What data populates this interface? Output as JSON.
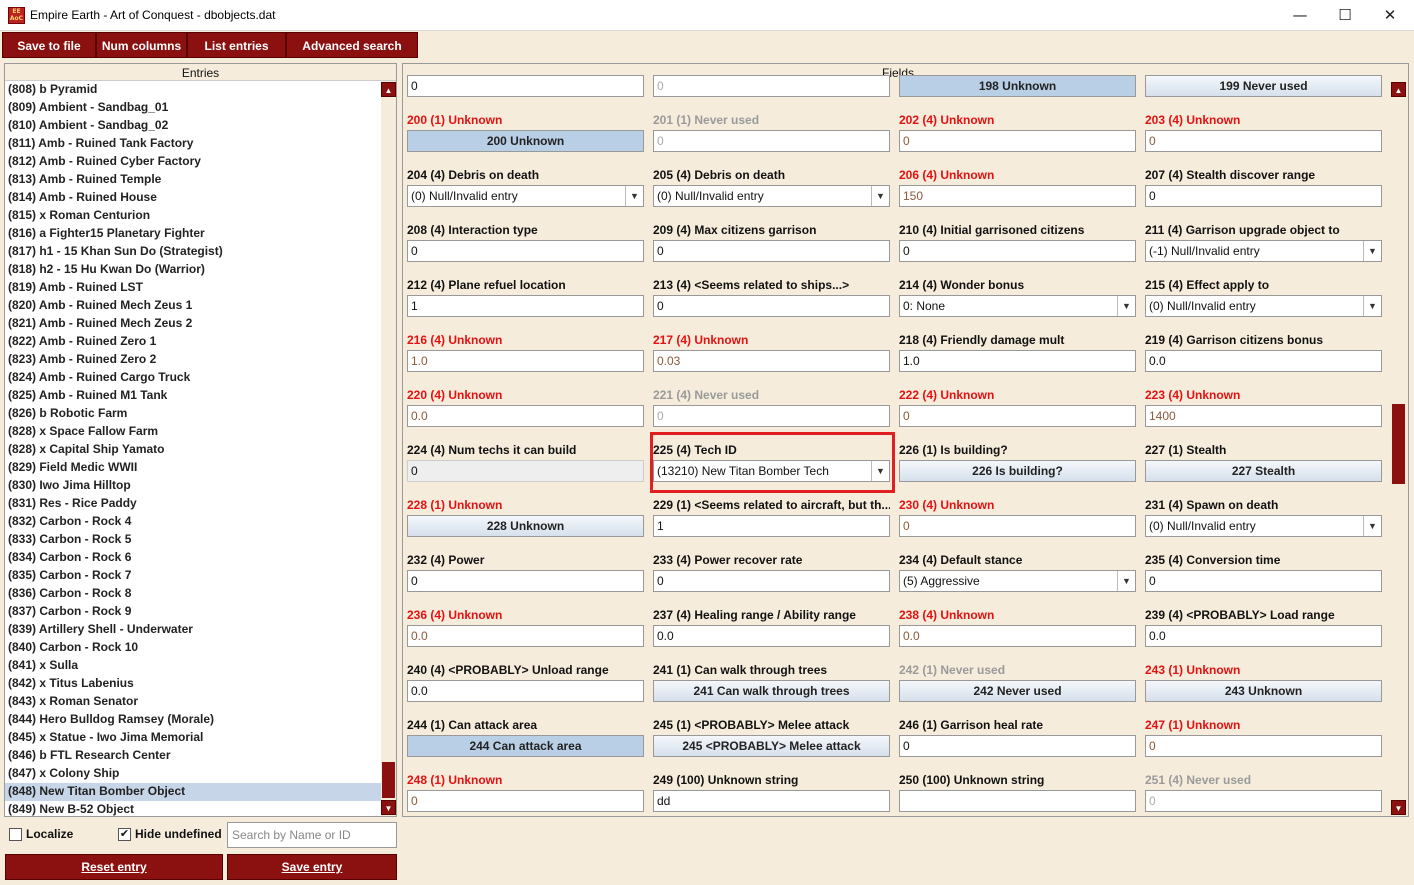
{
  "window": {
    "title": "Empire Earth - Art of Conquest - dbobjects.dat",
    "icon": "EE AoC",
    "minimize": "—",
    "maximize": "☐",
    "close": "✕"
  },
  "menu": {
    "save_to_file": "Save to file",
    "num_columns": "Num columns",
    "list_entries": "List entries",
    "advanced_search": "Advanced search"
  },
  "entries": {
    "header": "Entries",
    "items": [
      "(808) b  Pyramid",
      "(809) Ambient - Sandbag_01",
      "(810) Ambient - Sandbag_02",
      "(811) Amb - Ruined Tank Factory",
      "(812) Amb - Ruined Cyber Factory",
      "(813) Amb - Ruined Temple",
      "(814) Amb - Ruined House",
      "(815) x Roman Centurion",
      "(816) a Fighter15 Planetary Fighter",
      "(817) h1 - 15 Khan Sun Do (Strategist)",
      "(818) h2 - 15 Hu Kwan Do (Warrior)",
      "(819) Amb - Ruined LST",
      "(820) Amb - Ruined Mech Zeus 1",
      "(821) Amb - Ruined Mech Zeus 2",
      "(822) Amb - Ruined Zero 1",
      "(823) Amb - Ruined Zero 2",
      "(824) Amb - Ruined Cargo Truck",
      "(825) Amb - Ruined M1 Tank",
      "(826) b  Robotic Farm",
      "(828) x Space Fallow Farm",
      "(828) x Capital Ship Yamato",
      "(829) Field Medic WWII",
      "(830) Iwo Jima Hilltop",
      "(831) Res - Rice Paddy",
      "(832) Carbon - Rock 4",
      "(833) Carbon - Rock 5",
      "(834) Carbon - Rock 6",
      "(835) Carbon - Rock 7",
      "(836) Carbon - Rock 8",
      "(837) Carbon - Rock 9",
      "(839) Artillery Shell - Underwater",
      "(840) Carbon - Rock 10",
      "(841) x Sulla",
      "(842) x Titus Labenius",
      "(843) x Roman Senator",
      "(844) Hero Bulldog Ramsey (Morale)",
      "(845) x Statue - Iwo Jima Memorial",
      "(846) b  FTL Research Center",
      "(847) x Colony Ship",
      "(848) New Titan Bomber Object",
      "(849) New B-52 Object"
    ],
    "selected_index": 39
  },
  "options": {
    "localize_label": "Localize",
    "localize_checked": false,
    "hide_undefined_label": "Hide undefined",
    "hide_undefined_checked": true,
    "search_placeholder": "Search by Name or ID",
    "check_mark": "✔"
  },
  "actions": {
    "reset_entry": "Reset entry",
    "save_entry": "Save entry"
  },
  "fields": {
    "header": "Fields",
    "items": [
      {
        "label": "",
        "kind": "input",
        "value": "0"
      },
      {
        "label": "",
        "kind": "input",
        "value": "0",
        "valstyle": "dim"
      },
      {
        "label": "",
        "kind": "button",
        "value": "198 Unknown",
        "on": true
      },
      {
        "label": "",
        "kind": "button",
        "value": "199 Never used"
      },
      {
        "label": "200 (1) Unknown",
        "color": "red",
        "kind": "button",
        "value": "200 Unknown",
        "on": true
      },
      {
        "label": "201 (1) Never used",
        "color": "gray",
        "kind": "input",
        "value": "0",
        "valstyle": "dim"
      },
      {
        "label": "202 (4) Unknown",
        "color": "red",
        "kind": "input",
        "value": "0",
        "valstyle": "muted"
      },
      {
        "label": "203 (4) Unknown",
        "color": "red",
        "kind": "input",
        "value": "0",
        "valstyle": "muted"
      },
      {
        "label": "204 (4) Debris on death",
        "kind": "select",
        "value": "(0) Null/Invalid entry"
      },
      {
        "label": "205 (4) Debris on death",
        "kind": "select",
        "value": "(0) Null/Invalid entry"
      },
      {
        "label": "206 (4) Unknown",
        "color": "red",
        "kind": "input",
        "value": "150",
        "valstyle": "muted"
      },
      {
        "label": "207 (4) Stealth discover range",
        "kind": "input",
        "value": "0"
      },
      {
        "label": "208 (4) Interaction type",
        "kind": "input",
        "value": "0"
      },
      {
        "label": "209 (4) Max citizens garrison",
        "kind": "input",
        "value": "0"
      },
      {
        "label": "210 (4) Initial garrisoned citizens",
        "kind": "input",
        "value": "0"
      },
      {
        "label": "211 (4) Garrison upgrade object to",
        "kind": "select",
        "value": "(-1) Null/Invalid entry"
      },
      {
        "label": "212 (4) Plane refuel location",
        "kind": "input",
        "value": "1"
      },
      {
        "label": "213 (4) <Seems related to ships...>",
        "kind": "input",
        "value": "0"
      },
      {
        "label": "214 (4) Wonder bonus",
        "kind": "select",
        "value": "0: None"
      },
      {
        "label": "215 (4) Effect apply to",
        "kind": "select",
        "value": "(0) Null/Invalid entry"
      },
      {
        "label": "216 (4) Unknown",
        "color": "red",
        "kind": "input",
        "value": "1.0",
        "valstyle": "muted"
      },
      {
        "label": "217 (4) Unknown",
        "color": "red",
        "kind": "input",
        "value": "0.03",
        "valstyle": "muted"
      },
      {
        "label": "218 (4) Friendly damage mult",
        "kind": "input",
        "value": "1.0"
      },
      {
        "label": "219 (4) Garrison citizens bonus",
        "kind": "input",
        "value": "0.0"
      },
      {
        "label": "220 (4) Unknown",
        "color": "red",
        "kind": "input",
        "value": "0.0",
        "valstyle": "muted"
      },
      {
        "label": "221 (4) Never used",
        "color": "gray",
        "kind": "input",
        "value": "0",
        "valstyle": "dim"
      },
      {
        "label": "222 (4) Unknown",
        "color": "red",
        "kind": "input",
        "value": "0",
        "valstyle": "muted"
      },
      {
        "label": "223 (4) Unknown",
        "color": "red",
        "kind": "input",
        "value": "1400",
        "valstyle": "muted"
      },
      {
        "label": "224 (4) Num techs it can build",
        "kind": "input",
        "value": "0",
        "valstyle": "ro"
      },
      {
        "label": "225 (4) Tech ID",
        "kind": "select",
        "value": "(13210) New Titan Bomber Tech"
      },
      {
        "label": "226 (1) Is building?",
        "kind": "button",
        "value": "226 Is building?"
      },
      {
        "label": "227 (1) Stealth",
        "kind": "button",
        "value": "227 Stealth"
      },
      {
        "label": "228 (1) Unknown",
        "color": "red",
        "kind": "button",
        "value": "228 Unknown"
      },
      {
        "label": "229 (1) <Seems related to aircraft, but th...",
        "kind": "input",
        "value": "1"
      },
      {
        "label": "230 (4) Unknown",
        "color": "red",
        "kind": "input",
        "value": "0",
        "valstyle": "muted"
      },
      {
        "label": "231 (4) Spawn on death",
        "kind": "select",
        "value": "(0) Null/Invalid entry"
      },
      {
        "label": "232 (4) Power",
        "kind": "input",
        "value": "0"
      },
      {
        "label": "233 (4) Power recover rate",
        "kind": "input",
        "value": "0"
      },
      {
        "label": "234 (4) Default stance",
        "kind": "select",
        "value": "(5) Aggressive"
      },
      {
        "label": "235 (4) Conversion time",
        "kind": "input",
        "value": "0"
      },
      {
        "label": "236 (4) Unknown",
        "color": "red",
        "kind": "input",
        "value": "0.0",
        "valstyle": "muted"
      },
      {
        "label": "237 (4) Healing range / Ability range",
        "kind": "input",
        "value": "0.0"
      },
      {
        "label": "238 (4) Unknown",
        "color": "red",
        "kind": "input",
        "value": "0.0",
        "valstyle": "muted"
      },
      {
        "label": "239 (4) <PROBABLY> Load range",
        "kind": "input",
        "value": "0.0"
      },
      {
        "label": "240 (4) <PROBABLY> Unload range",
        "kind": "input",
        "value": "0.0"
      },
      {
        "label": "241 (1) Can walk through trees",
        "kind": "button",
        "value": "241 Can walk through trees"
      },
      {
        "label": "242 (1) Never used",
        "color": "gray",
        "kind": "button",
        "value": "242 Never used"
      },
      {
        "label": "243 (1) Unknown",
        "color": "red",
        "kind": "button",
        "value": "243 Unknown"
      },
      {
        "label": "244 (1) Can attack area",
        "kind": "button",
        "value": "244 Can attack area",
        "on": true
      },
      {
        "label": "245 (1) <PROBABLY> Melee attack",
        "kind": "button",
        "value": "245 <PROBABLY> Melee attack"
      },
      {
        "label": "246 (1) Garrison heal rate",
        "kind": "input",
        "value": "0"
      },
      {
        "label": "247 (1) Unknown",
        "color": "red",
        "kind": "input",
        "value": "0",
        "valstyle": "muted"
      },
      {
        "label": "248 (1) Unknown",
        "color": "red",
        "kind": "input",
        "value": "0",
        "valstyle": "muted"
      },
      {
        "label": "249 (100) Unknown string",
        "kind": "input",
        "value": "dd"
      },
      {
        "label": "250 (100) Unknown string",
        "kind": "input",
        "value": ""
      },
      {
        "label": "251 (4) Never used",
        "color": "gray",
        "kind": "input",
        "value": "0",
        "valstyle": "dim"
      }
    ]
  }
}
